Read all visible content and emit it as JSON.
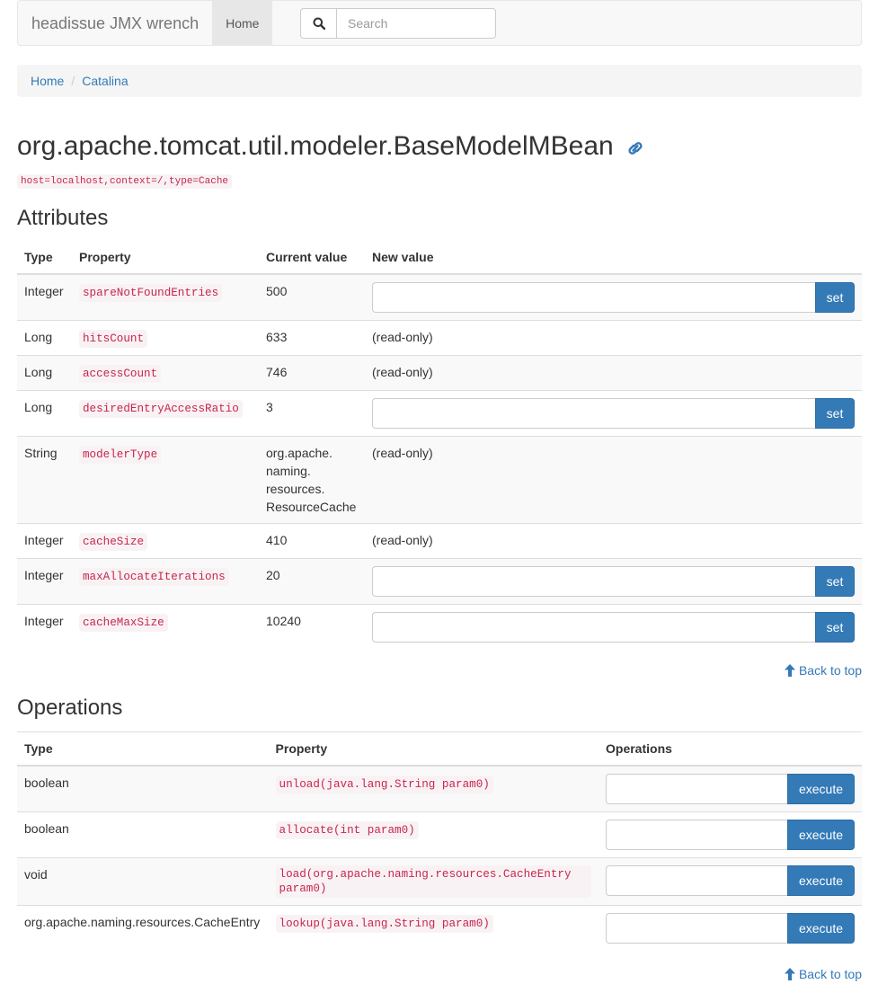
{
  "navbar": {
    "brand": "headissue JMX wrench",
    "home_label": "Home",
    "search_placeholder": "Search"
  },
  "breadcrumb": [
    "Home",
    "Catalina"
  ],
  "page": {
    "title": "org.apache.tomcat.util.modeler.BaseModelMBean",
    "object_name": "host=localhost,context=/,type=Cache"
  },
  "attributes": {
    "heading": "Attributes",
    "columns": [
      "Type",
      "Property",
      "Current value",
      "New value"
    ],
    "rows": [
      {
        "type": "Integer",
        "property": "spareNotFoundEntries",
        "value": "500",
        "writable": true
      },
      {
        "type": "Long",
        "property": "hitsCount",
        "value": "633",
        "writable": false,
        "readonly_text": "(read-only)"
      },
      {
        "type": "Long",
        "property": "accessCount",
        "value": "746",
        "writable": false,
        "readonly_text": "(read-only)"
      },
      {
        "type": "Long",
        "property": "desiredEntryAccessRatio",
        "value": "3",
        "writable": true
      },
      {
        "type": "String",
        "property": "modelerType",
        "value_lines": [
          "org.apache.",
          "naming.",
          "resources.",
          "ResourceCache"
        ],
        "writable": false,
        "readonly_text": "(read-only)"
      },
      {
        "type": "Integer",
        "property": "cacheSize",
        "value": "410",
        "writable": false,
        "readonly_text": "(read-only)"
      },
      {
        "type": "Integer",
        "property": "maxAllocateIterations",
        "value": "20",
        "writable": true
      },
      {
        "type": "Integer",
        "property": "cacheMaxSize",
        "value": "10240",
        "writable": true
      }
    ],
    "set_label": "set"
  },
  "operations": {
    "heading": "Operations",
    "columns": [
      "Type",
      "Property",
      "Operations"
    ],
    "rows": [
      {
        "type": "boolean",
        "signature": "unload(java.lang.String param0)"
      },
      {
        "type": "boolean",
        "signature": "allocate(int param0)"
      },
      {
        "type": "void",
        "signature": "load(org.apache.naming.resources.CacheEntry param0)"
      },
      {
        "type": "org.apache.naming.resources.CacheEntry",
        "signature": "lookup(java.lang.String param0)"
      }
    ],
    "execute_label": "execute"
  },
  "back_to_top": "Back to top",
  "colors": {
    "primary": "#337ab7",
    "code_bg": "#f9f2f4",
    "code_fg": "#c7254e"
  }
}
